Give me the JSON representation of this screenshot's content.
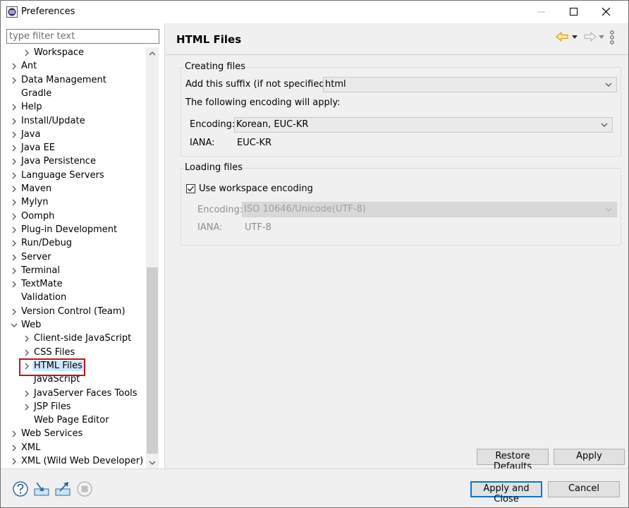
{
  "window": {
    "title": "Preferences"
  },
  "filter": {
    "placeholder": "type filter text"
  },
  "tree": {
    "items": [
      {
        "label": "Workspace",
        "indent": 1,
        "arrow": "right"
      },
      {
        "label": "Ant",
        "indent": 0,
        "arrow": "right"
      },
      {
        "label": "Data Management",
        "indent": 0,
        "arrow": "right"
      },
      {
        "label": "Gradle",
        "indent": 0,
        "arrow": "none"
      },
      {
        "label": "Help",
        "indent": 0,
        "arrow": "right"
      },
      {
        "label": "Install/Update",
        "indent": 0,
        "arrow": "right"
      },
      {
        "label": "Java",
        "indent": 0,
        "arrow": "right"
      },
      {
        "label": "Java EE",
        "indent": 0,
        "arrow": "right"
      },
      {
        "label": "Java Persistence",
        "indent": 0,
        "arrow": "right"
      },
      {
        "label": "Language Servers",
        "indent": 0,
        "arrow": "right"
      },
      {
        "label": "Maven",
        "indent": 0,
        "arrow": "right"
      },
      {
        "label": "Mylyn",
        "indent": 0,
        "arrow": "right"
      },
      {
        "label": "Oomph",
        "indent": 0,
        "arrow": "right"
      },
      {
        "label": "Plug-in Development",
        "indent": 0,
        "arrow": "right"
      },
      {
        "label": "Run/Debug",
        "indent": 0,
        "arrow": "right"
      },
      {
        "label": "Server",
        "indent": 0,
        "arrow": "right"
      },
      {
        "label": "Terminal",
        "indent": 0,
        "arrow": "right"
      },
      {
        "label": "TextMate",
        "indent": 0,
        "arrow": "right"
      },
      {
        "label": "Validation",
        "indent": 0,
        "arrow": "none"
      },
      {
        "label": "Version Control (Team)",
        "indent": 0,
        "arrow": "right"
      },
      {
        "label": "Web",
        "indent": 0,
        "arrow": "down"
      },
      {
        "label": "Client-side JavaScript",
        "indent": 1,
        "arrow": "right"
      },
      {
        "label": "CSS Files",
        "indent": 1,
        "arrow": "right"
      },
      {
        "label": "HTML Files",
        "indent": 1,
        "arrow": "right",
        "selected": true
      },
      {
        "label": "JavaScript",
        "indent": 1,
        "arrow": "none"
      },
      {
        "label": "JavaServer Faces Tools",
        "indent": 1,
        "arrow": "right"
      },
      {
        "label": "JSP Files",
        "indent": 1,
        "arrow": "right"
      },
      {
        "label": "Web Page Editor",
        "indent": 1,
        "arrow": "none"
      },
      {
        "label": "Web Services",
        "indent": 0,
        "arrow": "right"
      },
      {
        "label": "XML",
        "indent": 0,
        "arrow": "right"
      },
      {
        "label": "XML (Wild Web Developer)",
        "indent": 0,
        "arrow": "right"
      }
    ]
  },
  "page": {
    "title": "HTML Files"
  },
  "creating": {
    "group_title": "Creating files",
    "suffix_label": "Add this suffix (if not specified):",
    "suffix_value": "html",
    "encoding_note": "The following encoding will apply:",
    "encoding_label": "Encoding:",
    "encoding_value": "Korean, EUC-KR",
    "iana_label": "IANA:",
    "iana_value": "EUC-KR"
  },
  "loading": {
    "group_title": "Loading files",
    "use_workspace_label": "Use workspace encoding",
    "use_workspace_checked": true,
    "encoding_label": "Encoding:",
    "encoding_value": "ISO 10646/Unicode(UTF-8)",
    "iana_label": "IANA:",
    "iana_value": "UTF-8"
  },
  "buttons": {
    "restore_defaults": "Restore Defaults",
    "apply": "Apply",
    "apply_and_close": "Apply and Close",
    "cancel": "Cancel"
  },
  "colors": {
    "accent": "#0078d7",
    "selection": "#cce8ff",
    "highlight": "#c0121b",
    "nav_arrow": "#e8a317"
  },
  "bottom_icons": [
    "help-icon",
    "import-icon",
    "export-icon",
    "stop-icon"
  ]
}
